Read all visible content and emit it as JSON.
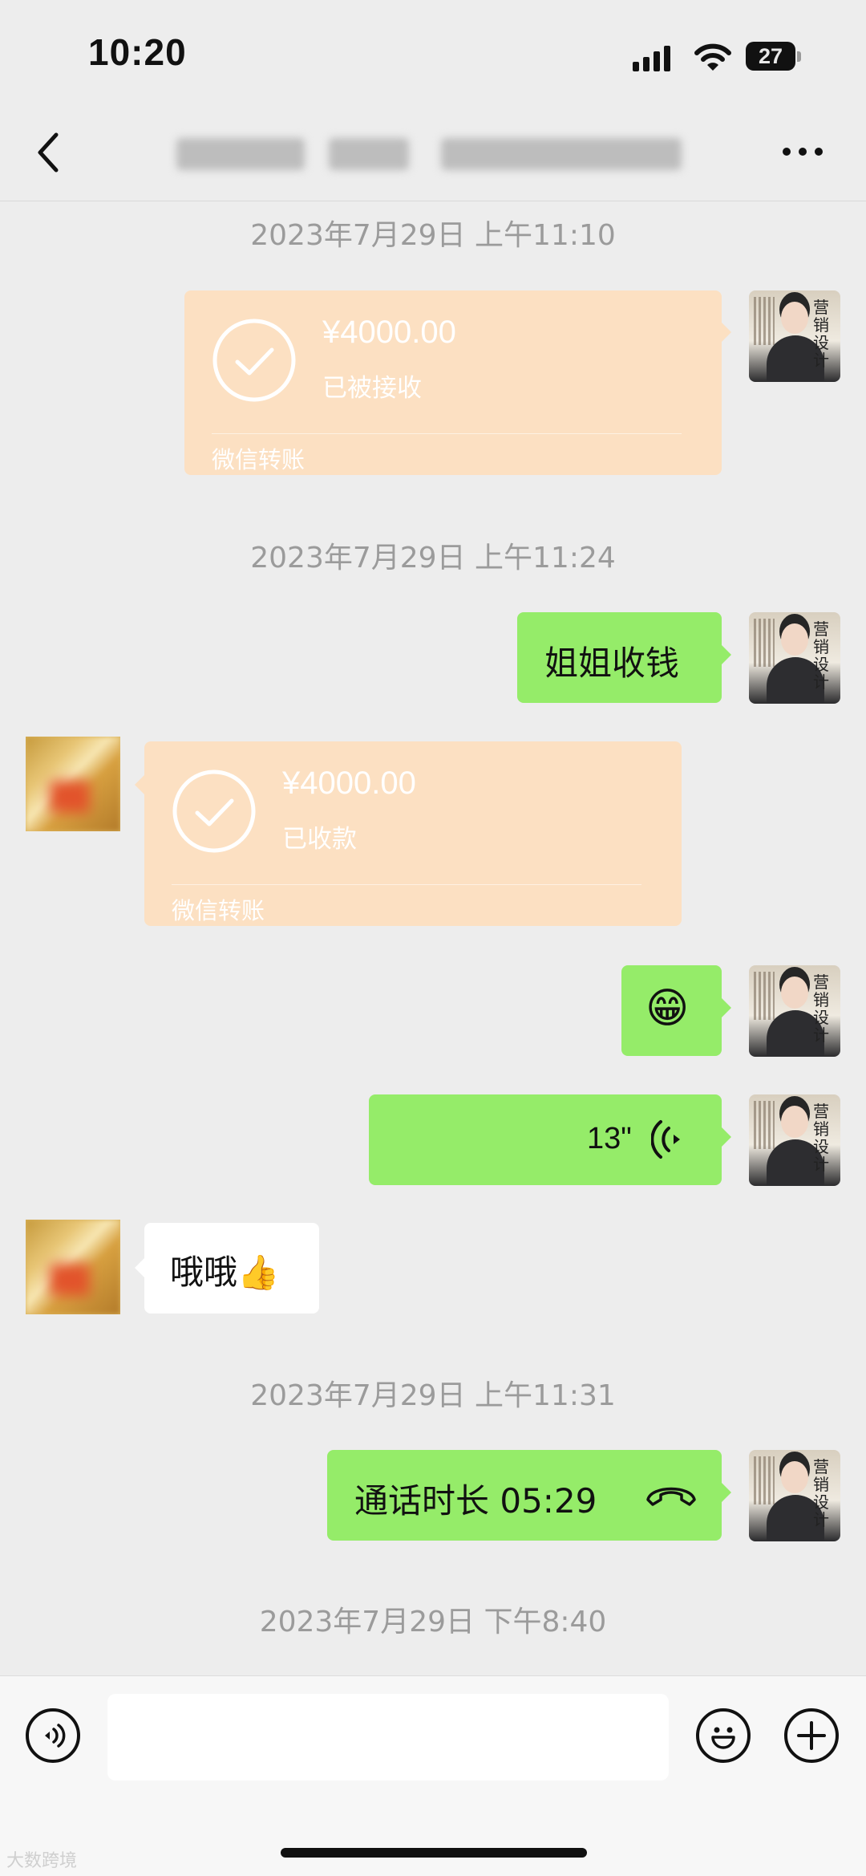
{
  "status_bar": {
    "time": "10:20",
    "battery": "27"
  },
  "nav": {
    "back_label": "<",
    "more_label": "...",
    "title": ""
  },
  "timestamps": [
    "2023年7月29日 上午11:10",
    "2023年7月29日 上午11:24",
    "2023年7月29日 上午11:31",
    "2023年7月29日 下午8:40"
  ],
  "messages": {
    "transfer_sent": {
      "amount": "¥4000.00",
      "status": "已被接收",
      "label": "微信转账"
    },
    "text_1": "姐姐收钱",
    "transfer_received": {
      "amount": "¥4000.00",
      "status": "已收款",
      "label": "微信转账"
    },
    "emoji": "😁",
    "voice": {
      "duration": "13\""
    },
    "reply": "哦哦👍",
    "call": {
      "text": "通话时长 05:29"
    }
  },
  "avatar_me": {
    "chars": "营销设计"
  },
  "watermark": "大数跨境",
  "colors": {
    "bg": "#ededed",
    "green_bubble": "#95ec69",
    "transfer": "#fce0c2"
  }
}
